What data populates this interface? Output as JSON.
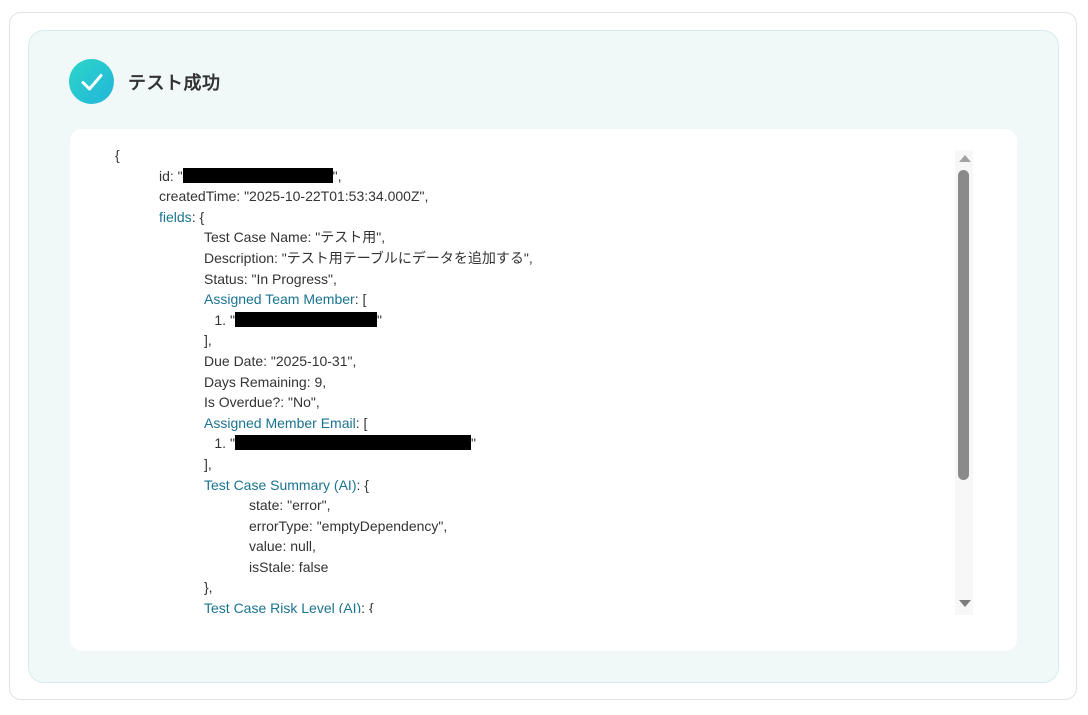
{
  "header": {
    "title": "テスト成功"
  },
  "icons": {
    "status": "check-icon",
    "accent": "#22c5d4"
  },
  "json": {
    "open_brace": "{",
    "id_key": "id: \"",
    "id_close": "\",",
    "created": "createdTime: \"2025-10-22T01:53:34.000Z\",",
    "fields_key": "fields",
    "fields_open": ": {",
    "test_case_name": "Test Case Name: \"テスト用\",",
    "description": "Description: \"テスト用テーブルにデータを追加する\",",
    "status": "Status: \"In Progress\",",
    "assigned_team_member_key": "Assigned Team Member",
    "bracket_open": ": [",
    "item_index": "1.",
    "quote_open": "\"",
    "quote_close": "\"",
    "bracket_close": "],",
    "due_date": "Due Date: \"2025-10-31\",",
    "days_remaining": "Days Remaining: 9,",
    "is_overdue": "Is Overdue?: \"No\",",
    "assigned_member_email_key": "Assigned Member Email",
    "summary_key": "Test Case Summary (AI)",
    "summary_open": ": {",
    "state": "state: \"error\",",
    "error_type": "errorType: \"emptyDependency\",",
    "value": "value: null,",
    "is_stale": "isStale: false",
    "summary_close": "},",
    "risk_key": "Test Case Risk Level (AI)",
    "risk_open": ": {"
  }
}
